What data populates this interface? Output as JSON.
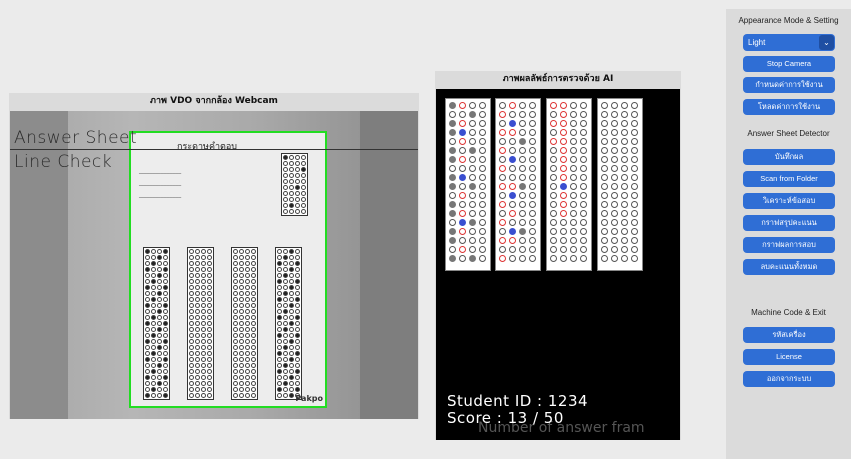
{
  "webcam_panel": {
    "title": "ภาพ VDO จากกล้อง Webcam",
    "overlay_line1": "Answer Sheet",
    "overlay_line2": "Line Check",
    "sheet_title": "กระดาษคำตอบ",
    "sheet_brand": "Pakpo"
  },
  "ai_panel": {
    "title": "ภาพผลลัพธ์การตรวจด้วย AI",
    "student_id_text": "Student ID : 1234",
    "score_text": "Score : 13 / 50",
    "faint_text": "Number of answer fram"
  },
  "sidebar": {
    "appearance_label": "Appearance Mode & Setting",
    "appearance_select_value": "Light",
    "stop_camera": "Stop Camera",
    "btn_set_defaults": "กำหนดค่าการใช้งาน",
    "btn_load_settings": "โหลดค่าการใช้งาน",
    "detector_label": "Answer Sheet Detector",
    "btn_save": "บันทึกผล",
    "btn_scan_folder": "Scan from Folder",
    "btn_analyze": "วิเคราะห์ข้อสอบ",
    "btn_summary_graph": "กราฟสรุปคะแนน",
    "btn_exam_graph": "กราฟผลการสอบ",
    "btn_clear_scores": "ลบคะแนนทั้งหมด",
    "machine_label": "Machine Code & Exit",
    "btn_machine_code": "รหัสเครื่อง",
    "btn_license": "License",
    "btn_exit": "ออกจากระบบ"
  },
  "colors": {
    "accent": "#2f6ed5",
    "detect_box": "#22dd22",
    "wrong_mark": "#dd3333",
    "answer_mark": "#3a4ed0"
  }
}
